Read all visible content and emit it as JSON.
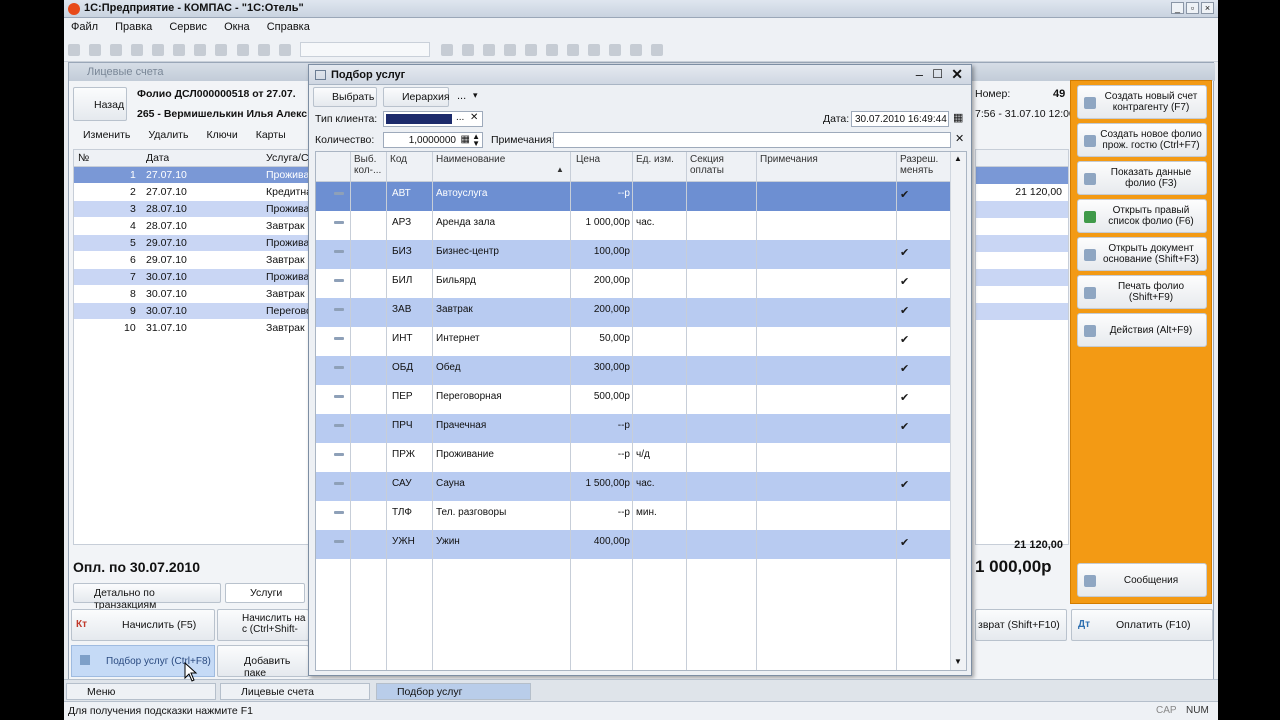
{
  "app": {
    "title": "1С:Предприятие - КОМПАС - \"1С:Отель\""
  },
  "menu": [
    "Файл",
    "Правка",
    "Сервис",
    "Окна",
    "Справка"
  ],
  "left_window": {
    "title": "Лицевые счета",
    "back": "Назад",
    "folio_line1": "Фолио ДСЛ000000518 от 27.07.",
    "folio_line2": "265 - Вермишелькин Илья Алекс",
    "number_label": "Номер:",
    "number_value": "49",
    "period": "7:56 - 31.07.10 12:00",
    "actions": {
      "edit": "Изменить",
      "delete": "Удалить",
      "keys": "Ключи",
      "cards": "Карты"
    },
    "grid_headers": {
      "no": "№",
      "date": "Дата",
      "service": "Услуга/С"
    },
    "rows": [
      {
        "no": "1",
        "date": "27.07.10",
        "service": "Проживан"
      },
      {
        "no": "2",
        "date": "27.07.10",
        "service": "Кредитна"
      },
      {
        "no": "3",
        "date": "28.07.10",
        "service": "Проживан"
      },
      {
        "no": "4",
        "date": "28.07.10",
        "service": "Завтрак"
      },
      {
        "no": "5",
        "date": "29.07.10",
        "service": "Проживан"
      },
      {
        "no": "6",
        "date": "29.07.10",
        "service": "Завтрак"
      },
      {
        "no": "7",
        "date": "30.07.10",
        "service": "Проживан"
      },
      {
        "no": "8",
        "date": "30.07.10",
        "service": "Завтрак"
      },
      {
        "no": "9",
        "date": "30.07.10",
        "service": "Перегово"
      },
      {
        "no": "10",
        "date": "31.07.10",
        "service": "Завтрак"
      }
    ],
    "right_amount": "21 120,00",
    "right_total": "21 120,00",
    "paid_label": "Опл. по 30.07.2010",
    "paid_amount": "1 000,00р",
    "subtabs": {
      "detail": "Детально по транзакциям",
      "services": "Услуги"
    },
    "buttons": {
      "charge": "Начислить (F5)",
      "charge_by": "Начислить на с (Ctrl+Shift-",
      "pick": "Подбор услуг (Ctrl+F8)",
      "add_package": "Добавить паке",
      "refund": "зврат (Shift+F10)",
      "pay": "Оплатить (F10)"
    },
    "side_buttons": [
      "Создать новый счет контрагенту (F7)",
      "Создать новое фолио прож. гостю (Ctrl+F7)",
      "Показать данные фолио (F3)",
      "Открыть правый список фолио (F6)",
      "Открыть документ основание (Shift+F3)",
      "Печать фолио (Shift+F9)",
      "Действия (Alt+F9)"
    ],
    "messages": "Сообщения"
  },
  "dialog": {
    "title": "Подбор услуг",
    "btn_select": "Выбрать",
    "btn_hierarchy": "Иерархия",
    "btn_more": "...",
    "client_type_label": "Тип клиента:",
    "date_label": "Дата:",
    "date_value": "30.07.2010 16:49:44",
    "qty_label": "Количество:",
    "qty_value": "1,0000000",
    "notes_label": "Примечания:",
    "headers": {
      "sel": "Выб. кол-...",
      "code": "Код",
      "name": "Наименование",
      "price": "Цена",
      "unit": "Ед. изм.",
      "section": "Секция оплаты",
      "notes": "Примечания",
      "allow": "Разреш. менять"
    },
    "rows": [
      {
        "code": "АВТ",
        "name": "Автоуслуга",
        "price": "--р",
        "unit": "",
        "allow": "✔"
      },
      {
        "code": "АРЗ",
        "name": "Аренда зала",
        "price": "1 000,00р",
        "unit": "час.",
        "allow": ""
      },
      {
        "code": "БИЗ",
        "name": "Бизнес-центр",
        "price": "100,00р",
        "unit": "",
        "allow": "✔"
      },
      {
        "code": "БИЛ",
        "name": "Бильярд",
        "price": "200,00р",
        "unit": "",
        "allow": "✔"
      },
      {
        "code": "ЗАВ",
        "name": "Завтрак",
        "price": "200,00р",
        "unit": "",
        "allow": "✔"
      },
      {
        "code": "ИНТ",
        "name": "Интернет",
        "price": "50,00р",
        "unit": "",
        "allow": "✔"
      },
      {
        "code": "ОБД",
        "name": "Обед",
        "price": "300,00р",
        "unit": "",
        "allow": "✔"
      },
      {
        "code": "ПЕР",
        "name": "Переговорная",
        "price": "500,00р",
        "unit": "",
        "allow": "✔"
      },
      {
        "code": "ПРЧ",
        "name": "Прачечная",
        "price": "--р",
        "unit": "",
        "allow": "✔"
      },
      {
        "code": "ПРЖ",
        "name": "Проживание",
        "price": "--р",
        "unit": "ч/д",
        "allow": ""
      },
      {
        "code": "САУ",
        "name": "Сауна",
        "price": "1 500,00р",
        "unit": "час.",
        "allow": "✔"
      },
      {
        "code": "ТЛФ",
        "name": "Тел. разговоры",
        "price": "--р",
        "unit": "мин.",
        "allow": ""
      },
      {
        "code": "УЖН",
        "name": "Ужин",
        "price": "400,00р",
        "unit": "",
        "allow": "✔"
      }
    ]
  },
  "taskbar": [
    "Меню",
    "Лицевые счета",
    "Подбор услуг"
  ],
  "status": {
    "hint": "Для получения подсказки нажмите F1",
    "cap": "CAP",
    "num": "NUM"
  }
}
